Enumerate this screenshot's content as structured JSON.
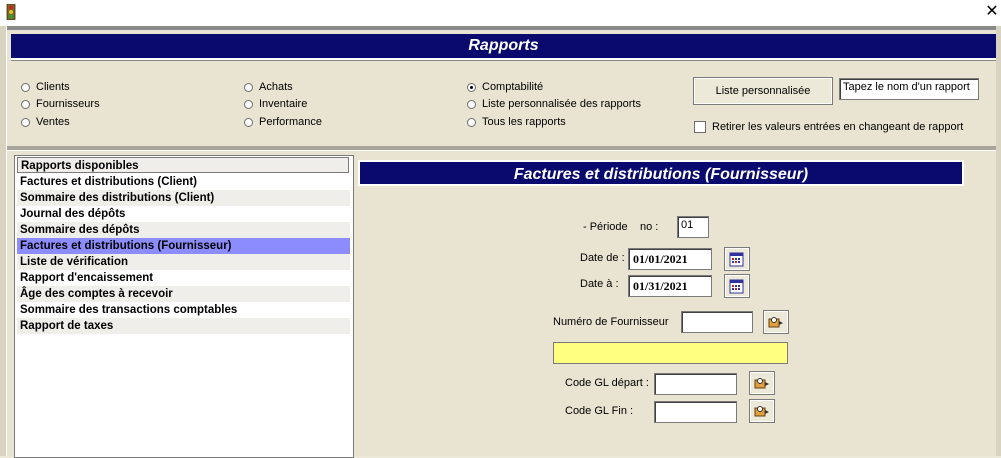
{
  "window": {
    "close_glyph": "✕"
  },
  "header": {
    "title": "Rapports"
  },
  "options": {
    "col1": [
      {
        "label": "Clients",
        "selected": false
      },
      {
        "label": "Fournisseurs",
        "selected": false
      },
      {
        "label": "Ventes",
        "selected": false
      }
    ],
    "col2": [
      {
        "label": "Achats",
        "selected": false
      },
      {
        "label": "Inventaire",
        "selected": false
      },
      {
        "label": "Performance",
        "selected": false
      }
    ],
    "col3": [
      {
        "label": "Comptabilité",
        "selected": true
      },
      {
        "label": "Liste personnalisée des rapports",
        "selected": false
      },
      {
        "label": "Tous les rapports",
        "selected": false
      }
    ],
    "custom_list_button": "Liste personnalisée",
    "report_name_value": "Tapez le nom d'un rapport",
    "clear_values_checkbox": "Retirer les valeurs entrées en changeant de rapport",
    "clear_values_checked": false
  },
  "report_list": {
    "header": "Rapports disponibles",
    "items": [
      {
        "label": "Factures et distributions (Client)"
      },
      {
        "label": "Sommaire des distributions (Client)"
      },
      {
        "label": "Journal des dépôts"
      },
      {
        "label": "Sommaire des dépôts"
      },
      {
        "label": "Factures et distributions (Fournisseur)",
        "selected": true
      },
      {
        "label": "Liste de vérification"
      },
      {
        "label": "Rapport d'encaissement"
      },
      {
        "label": "Âge des comptes à recevoir"
      },
      {
        "label": "Sommaire des transactions comptables"
      },
      {
        "label": "Rapport de taxes"
      }
    ]
  },
  "form": {
    "title": "Factures et distributions (Fournisseur)",
    "period_label": "- Période",
    "period_no_label": "no :",
    "period_value": "01",
    "date_from_label": "Date de :",
    "date_from_value": "01/01/2021",
    "date_to_label": "Date à :",
    "date_to_value": "01/31/2021",
    "supplier_label": "Numéro de Fournisseur",
    "supplier_value": "",
    "supplier_name_value": "",
    "gl_start_label": "Code GL départ :",
    "gl_start_value": "",
    "gl_end_label": "Code GL Fin :",
    "gl_end_value": ""
  },
  "colors": {
    "banner_bg": "#0a0a6e",
    "selected_row": "#8c8cff",
    "supplier_name_bg": "#ffff80",
    "panel_bg": "#e9e3d1"
  }
}
